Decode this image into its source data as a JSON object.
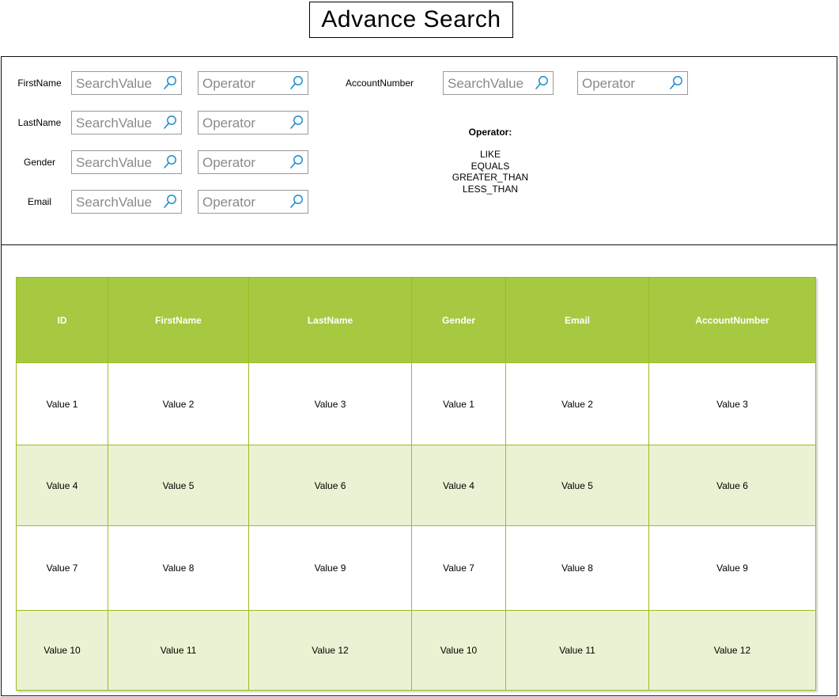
{
  "title": "Advance Search",
  "search": {
    "fields": [
      {
        "label": "FirstName",
        "value_placeholder": "SearchValue",
        "operator_placeholder": "Operator"
      },
      {
        "label": "LastName",
        "value_placeholder": "SearchValue",
        "operator_placeholder": "Operator"
      },
      {
        "label": "Gender",
        "value_placeholder": "SearchValue",
        "operator_placeholder": "Operator"
      },
      {
        "label": "Email",
        "value_placeholder": "SearchValue",
        "operator_placeholder": "Operator"
      },
      {
        "label": "AccountNumber",
        "value_placeholder": "SearchValue",
        "operator_placeholder": "Operator"
      }
    ],
    "operator_help": {
      "heading": "Operator:",
      "operators": [
        "LIKE",
        "EQUALS",
        "GREATER_THAN",
        "LESS_THAN"
      ]
    }
  },
  "table": {
    "columns": [
      "ID",
      "FirstName",
      "LastName",
      "Gender",
      "Email",
      "AccountNumber"
    ],
    "rows": [
      [
        "Value 1",
        "Value 2",
        "Value 3",
        "Value 1",
        "Value 2",
        "Value 3"
      ],
      [
        "Value 4",
        "Value 5",
        "Value 6",
        "Value 4",
        "Value 5",
        "Value 6"
      ],
      [
        "Value 7",
        "Value 8",
        "Value 9",
        "Value 7",
        "Value 8",
        "Value 9"
      ],
      [
        "Value 10",
        "Value 11",
        "Value 12",
        "Value 10",
        "Value 11",
        "Value 12"
      ]
    ]
  },
  "colors": {
    "header_bg": "#a7c942",
    "header_text": "#ffffff",
    "row_alt_bg": "#eaf2d3",
    "border": "#98bf21",
    "search_icon": "#1f8fce"
  },
  "icons": {
    "search": "search-icon"
  }
}
